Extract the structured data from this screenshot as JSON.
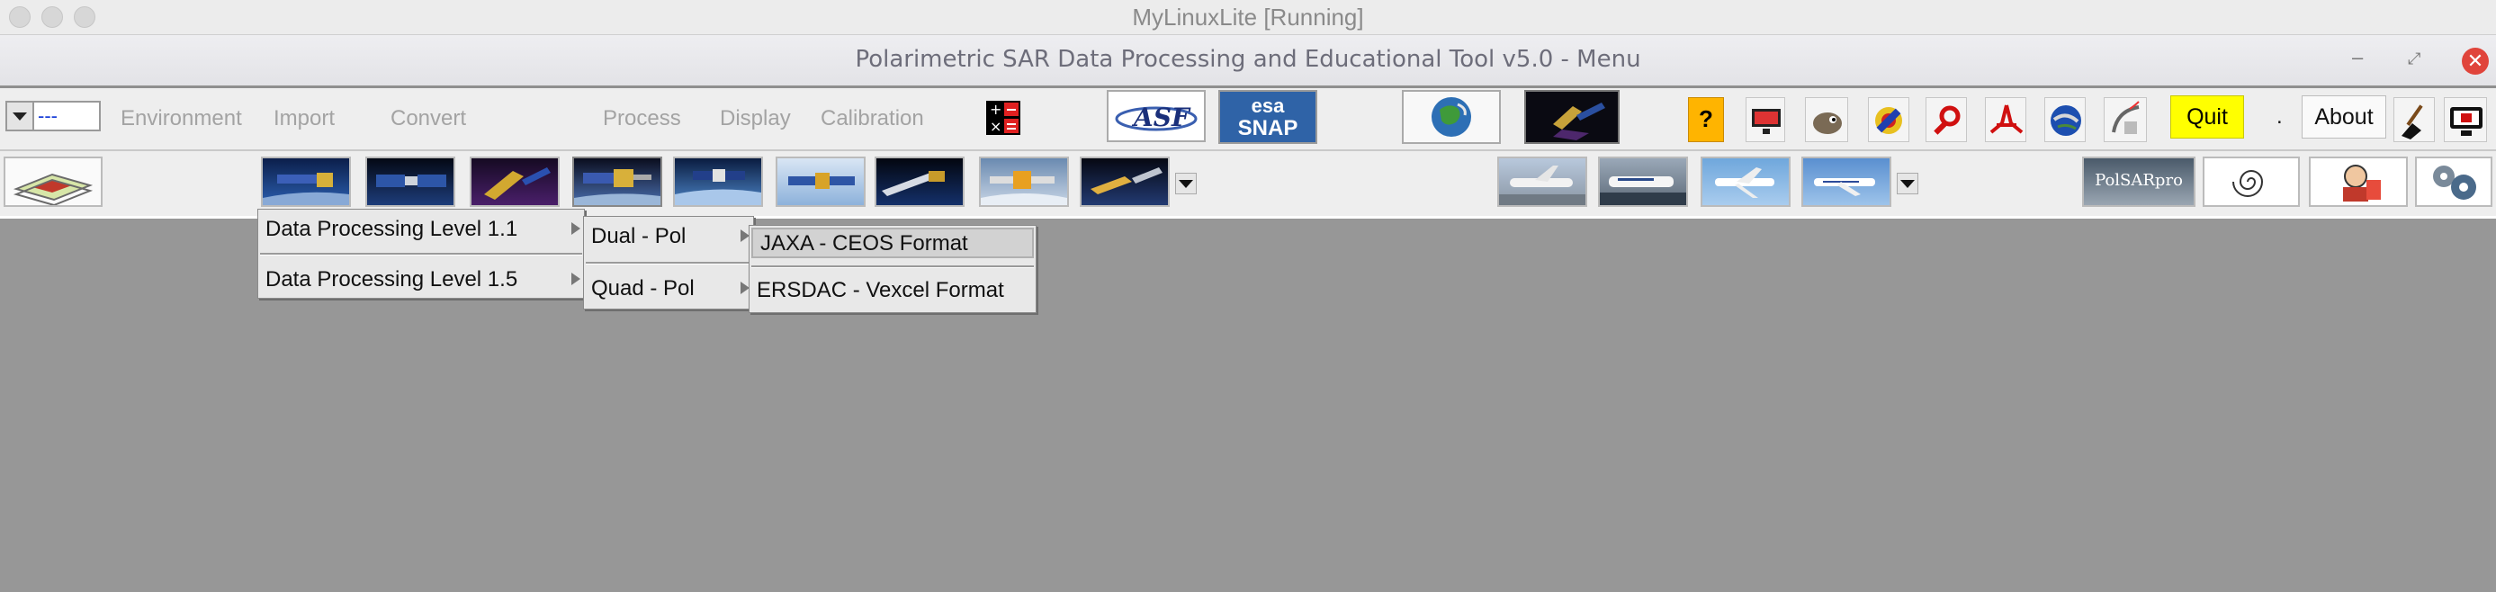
{
  "host": {
    "title": "MyLinuxLite [Running]"
  },
  "app": {
    "title": "Polarimetric SAR Data Processing and Educational Tool v5.0 - Menu",
    "win_min": "–",
    "win_max": "⤢",
    "win_close": "✕"
  },
  "menubar": {
    "mode_value": "---",
    "items": [
      "Environment",
      "Import",
      "Convert",
      "Process",
      "Display",
      "Calibration"
    ],
    "quit_label": "Quit",
    "dot_label": ".",
    "about_label": "About",
    "asf_label": "ASF",
    "snap_top": "esa",
    "snap_bottom": "SNAP",
    "polsarpro_label": "PolSARpro"
  },
  "popup1": {
    "items": [
      "Data Processing Level 1.1",
      "Data Processing Level 1.5"
    ]
  },
  "popup2": {
    "items": [
      "Dual - Pol",
      "Quad - Pol"
    ]
  },
  "popup3": {
    "items": [
      "JAXA - CEOS Format",
      "ERSDAC - Vexcel Format"
    ]
  },
  "colors": {
    "quit_bg": "#ffff00",
    "desktop_bg": "#979797",
    "close_red": "#e0443b"
  }
}
